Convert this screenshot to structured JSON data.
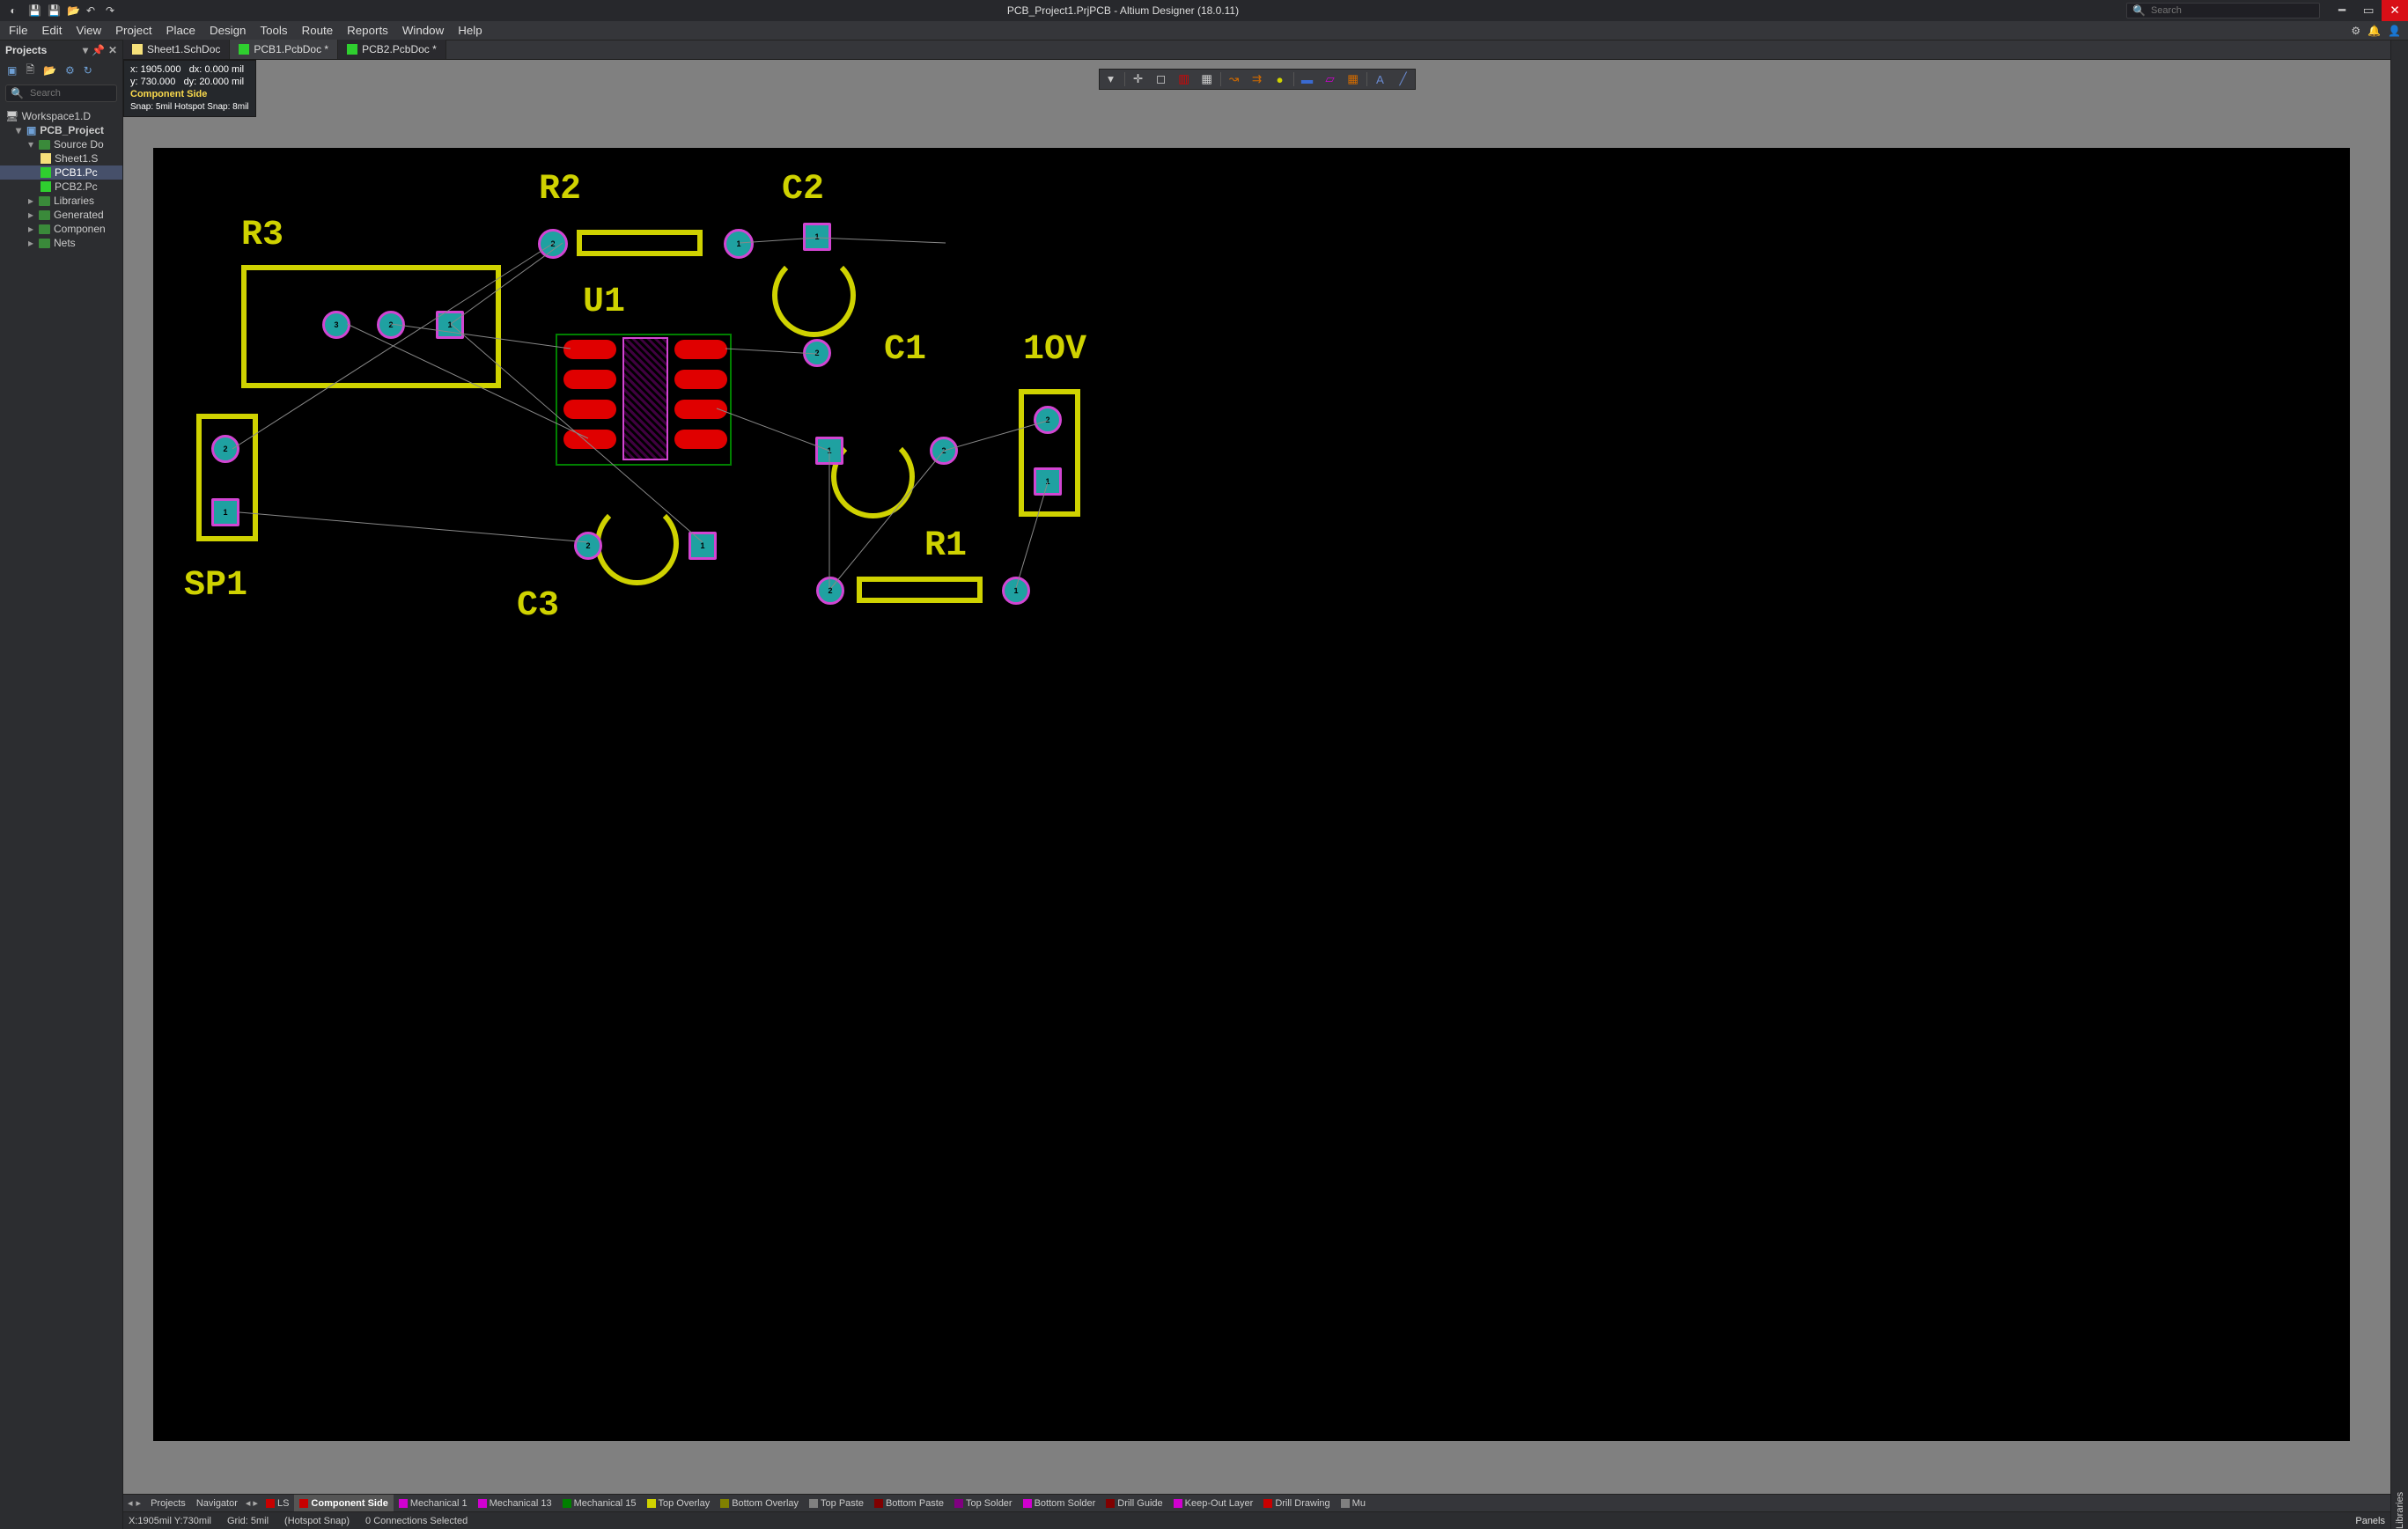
{
  "window_title": "PCB_Project1.PrjPCB - Altium Designer (18.0.11)",
  "titlebar_search_placeholder": "Search",
  "main_menu": [
    "File",
    "Edit",
    "View",
    "Project",
    "Place",
    "Design",
    "Tools",
    "Route",
    "Reports",
    "Window",
    "Help"
  ],
  "doc_tabs": [
    {
      "label": "Sheet1.SchDoc",
      "type": "sch",
      "active": false,
      "dirty": false
    },
    {
      "label": "PCB1.PcbDoc",
      "type": "pcb",
      "active": true,
      "dirty": true
    },
    {
      "label": "PCB2.PcbDoc",
      "type": "pcb",
      "active": false,
      "dirty": true
    }
  ],
  "projects_panel": {
    "title": "Projects",
    "search_placeholder": "Search",
    "tree": {
      "workspace": "Workspace1.D",
      "project": "PCB_Project",
      "source_folder": "Source Do",
      "files": [
        {
          "name": "Sheet1.S",
          "type": "sch",
          "selected": false
        },
        {
          "name": "PCB1.Pc",
          "type": "pcb",
          "selected": true
        },
        {
          "name": "PCB2.Pc",
          "type": "pcb",
          "selected": false
        }
      ],
      "other_folders": [
        "Libraries",
        "Generated",
        "Componen",
        "Nets"
      ]
    }
  },
  "side_rail_label": "Libraries",
  "hud": {
    "x_label": "x:",
    "x_val": "1905.000",
    "dx_label": "dx:",
    "dx_val": "0.000",
    "y_label": "y:",
    "y_val": "730.000",
    "dy_label": "dy:",
    "dy_val": "20.000",
    "unit": "mil",
    "layer": "Component Side",
    "snap": "Snap: 5mil Hotspot Snap: 8mil"
  },
  "component_labels": [
    "R3",
    "R2",
    "C2",
    "U1",
    "C1",
    "1OV",
    "SP1",
    "C3",
    "R1"
  ],
  "layerbar_left": [
    "Projects",
    "Navigator"
  ],
  "layerbar_layers": [
    {
      "name": "LS",
      "color": "#c80000",
      "active": false
    },
    {
      "name": "Component Side",
      "color": "#c80000",
      "active": true
    },
    {
      "name": "Mechanical 1",
      "color": "#d000d0"
    },
    {
      "name": "Mechanical 13",
      "color": "#d000d0"
    },
    {
      "name": "Mechanical 15",
      "color": "#008000"
    },
    {
      "name": "Top Overlay",
      "color": "#cfd200"
    },
    {
      "name": "Bottom Overlay",
      "color": "#808000"
    },
    {
      "name": "Top Paste",
      "color": "#808080"
    },
    {
      "name": "Bottom Paste",
      "color": "#800000"
    },
    {
      "name": "Top Solder",
      "color": "#800080"
    },
    {
      "name": "Bottom Solder",
      "color": "#d000d0"
    },
    {
      "name": "Drill Guide",
      "color": "#800000"
    },
    {
      "name": "Keep-Out Layer",
      "color": "#d000d0"
    },
    {
      "name": "Drill Drawing",
      "color": "#c80000"
    },
    {
      "name": "Mu",
      "color": "#808080"
    }
  ],
  "statusbar": {
    "coords": "X:1905mil Y:730mil",
    "grid": "Grid: 5mil",
    "hotspot": "(Hotspot Snap)",
    "selection": "0 Connections Selected",
    "panels": "Panels"
  }
}
